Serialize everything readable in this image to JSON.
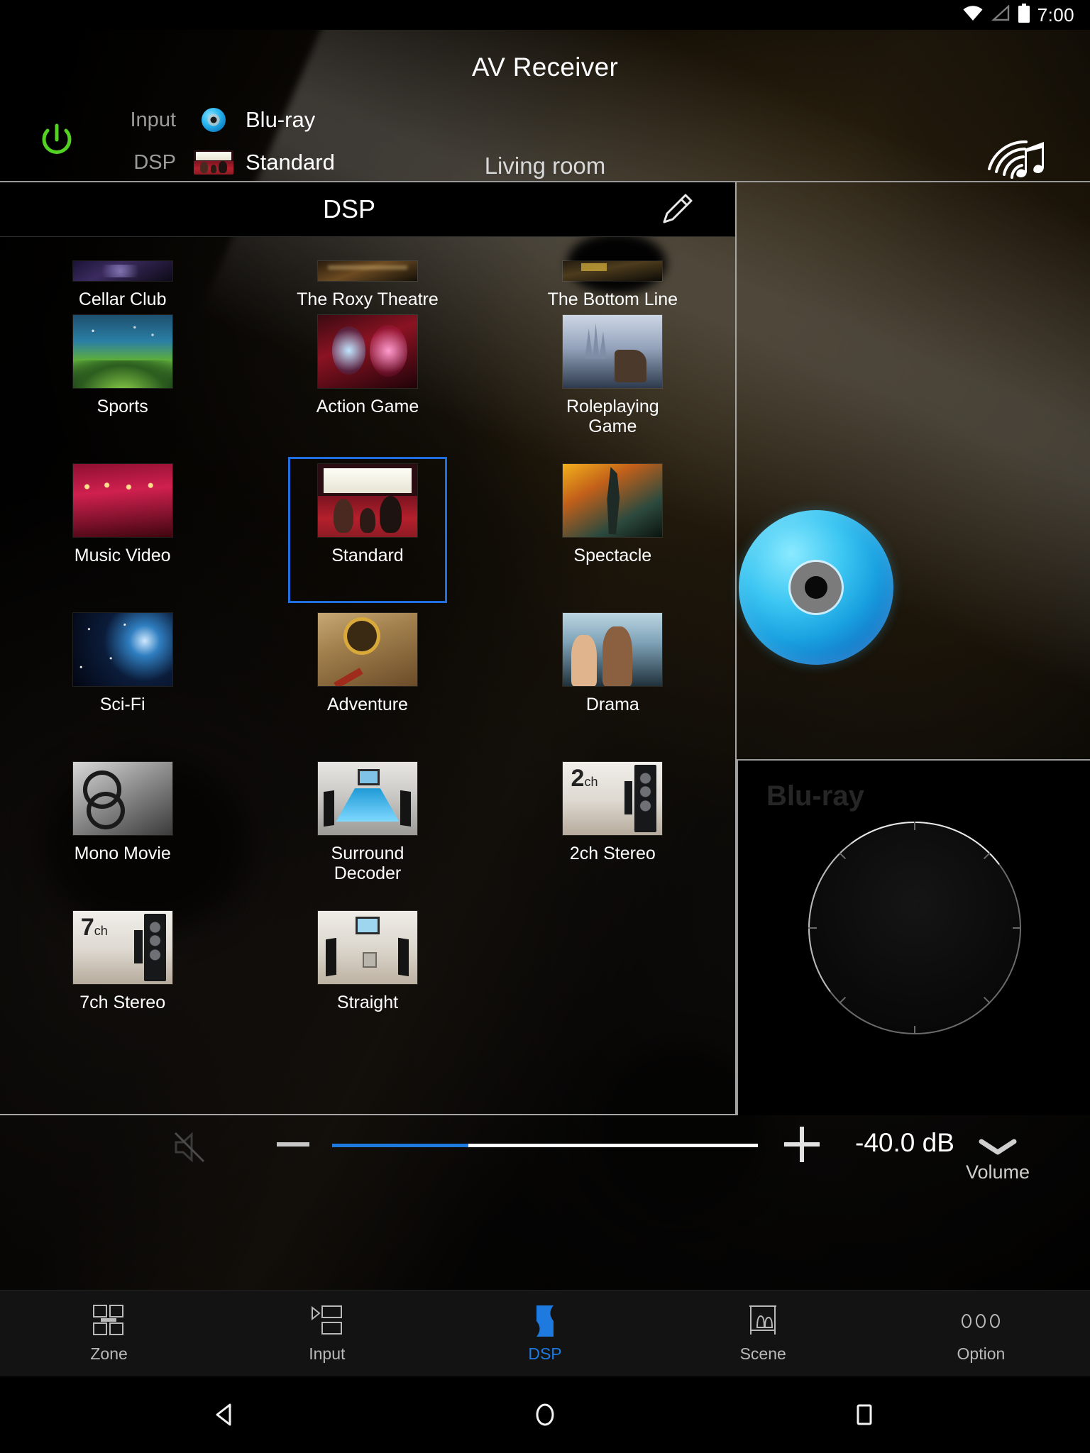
{
  "status_bar": {
    "time": "7:00",
    "icons": [
      "wifi-icon",
      "signal-icon",
      "battery-icon"
    ]
  },
  "header": {
    "app_title": "AV Receiver",
    "zone_name": "Living room",
    "power_icon": "power-icon",
    "musiccast_icon": "musiccast-icon",
    "rows": [
      {
        "label": "Input",
        "value": "Blu-ray",
        "thumb": "bluray-disc-icon"
      },
      {
        "label": "DSP",
        "value": "Standard",
        "thumb": "cinema-thumbnail"
      }
    ]
  },
  "dsp_panel": {
    "title": "DSP",
    "edit_icon": "pencil-icon",
    "selected_program": "Standard",
    "programs": [
      {
        "label": "Cellar Club",
        "art": "t-cellar",
        "clipped": true
      },
      {
        "label": "The Roxy Theatre",
        "art": "t-roxy",
        "clipped": true
      },
      {
        "label": "The Bottom Line",
        "art": "t-bottom",
        "clipped": true
      },
      {
        "label": "Sports",
        "art": "t-sports"
      },
      {
        "label": "Action Game",
        "art": "t-action"
      },
      {
        "label": "Roleplaying Game",
        "art": "t-rpg"
      },
      {
        "label": "Music Video",
        "art": "t-musicvideo"
      },
      {
        "label": "Standard",
        "art": "t-standard",
        "selected": true
      },
      {
        "label": "Spectacle",
        "art": "t-spectacle"
      },
      {
        "label": "Sci-Fi",
        "art": "t-scifi"
      },
      {
        "label": "Adventure",
        "art": "t-adventure"
      },
      {
        "label": "Drama",
        "art": "t-drama"
      },
      {
        "label": "Mono Movie",
        "art": "t-mono"
      },
      {
        "label": "Surround Decoder",
        "art": "t-surround"
      },
      {
        "label": "2ch Stereo",
        "art": "t-2ch",
        "badge": "2",
        "badge_unit": "ch"
      },
      {
        "label": "7ch Stereo",
        "art": "t-7ch",
        "badge": "7",
        "badge_unit": "ch"
      },
      {
        "label": "Straight",
        "art": "t-straight"
      }
    ]
  },
  "now_playing": {
    "disc_icon": "bluray-disc-large-icon"
  },
  "dial_panel": {
    "source_label": "Blu-ray",
    "dial_name": "volume-dial"
  },
  "volume": {
    "collapse_label": "Volume",
    "collapse_icon": "chevron-down-icon",
    "mute_icon": "mute-icon",
    "minus_label": "minus-icon",
    "plus_label": "plus-icon",
    "level_text": "-40.0 dB",
    "fill_percent": 32
  },
  "tabbar": {
    "active": "DSP",
    "tabs": [
      {
        "label": "Zone",
        "icon": "zone-icon"
      },
      {
        "label": "Input",
        "icon": "input-icon"
      },
      {
        "label": "DSP",
        "icon": "dsp-icon"
      },
      {
        "label": "Scene",
        "icon": "scene-icon"
      },
      {
        "label": "Option",
        "icon": "option-icon"
      }
    ]
  },
  "android_nav": {
    "back": "back-icon",
    "home": "home-icon",
    "recents": "recents-icon"
  },
  "colors": {
    "accent": "#1f7ae0",
    "power_green": "#54d223",
    "panel_border": "#9a9a9a",
    "background": "#000000"
  }
}
